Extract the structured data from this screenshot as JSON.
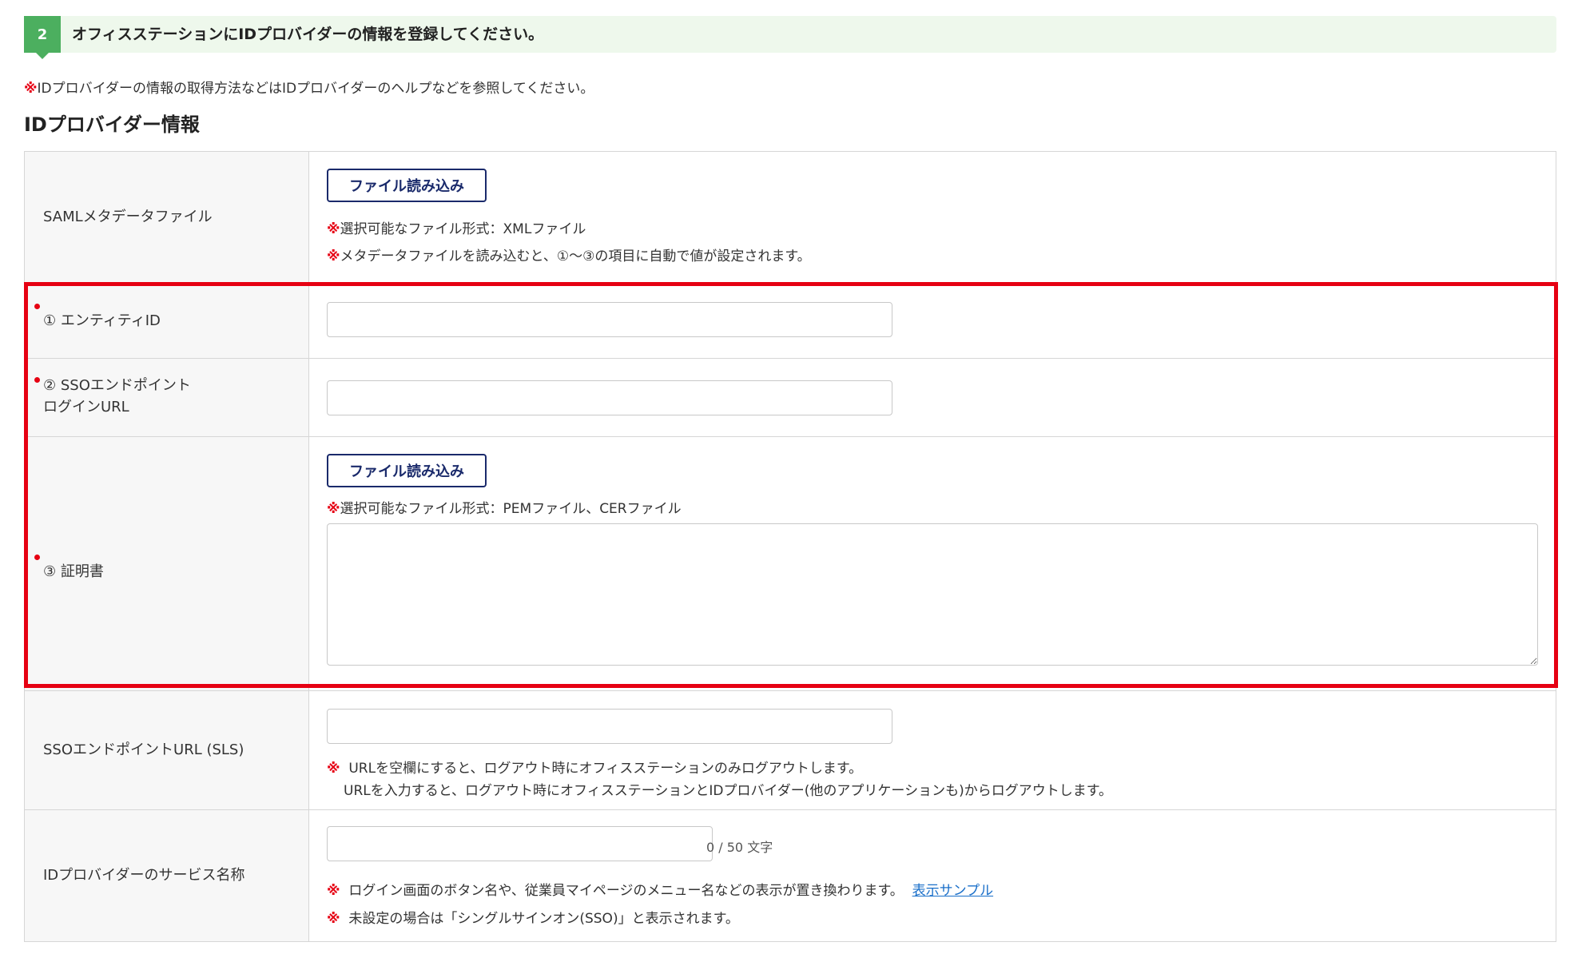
{
  "step": {
    "number": "2",
    "title": "オフィスステーションにIDプロバイダーの情報を登録してください。"
  },
  "notice": {
    "mark": "※",
    "text": "IDプロバイダーの情報の取得方法などはIDプロバイダーのヘルプなどを参照してください。"
  },
  "section_heading": "IDプロバイダー情報",
  "rows": {
    "saml": {
      "label": "SAMLメタデータファイル",
      "button": "ファイル読み込み",
      "note1": "選択可能なファイル形式：XMLファイル",
      "note2": "メタデータファイルを読み込むと、①～③の項目に自動で値が設定されます。"
    },
    "entity": {
      "label": "① エンティティID",
      "value": ""
    },
    "sso_login": {
      "label_line1": "② SSOエンドポイント",
      "label_line2": "ログインURL",
      "value": ""
    },
    "cert": {
      "label": "③ 証明書",
      "button": "ファイル読み込み",
      "note": "選択可能なファイル形式：PEMファイル、CERファイル",
      "value": ""
    },
    "sls": {
      "label": "SSOエンドポイントURL (SLS)",
      "value": "",
      "note1": "URLを空欄にすると、ログアウト時にオフィスステーションのみログアウトします。",
      "note2": "URLを入力すると、ログアウト時にオフィスステーションとIDプロバイダー(他のアプリケーションも)からログアウトします。"
    },
    "service_name": {
      "label": "IDプロバイダーのサービス名称",
      "value": "",
      "counter": "0 / 50 文字",
      "note1": "ログイン画面のボタン名や、従業員マイページのメニュー名などの表示が置き換わります。",
      "link": "表示サンプル",
      "note2": "未設定の場合は「シングルサインオン(SSO)」と表示されます。"
    }
  },
  "colors": {
    "accent_green": "#4caf5f",
    "required_red": "#e60012",
    "button_navy": "#1a2a6b",
    "link_blue": "#1a6fc9"
  }
}
